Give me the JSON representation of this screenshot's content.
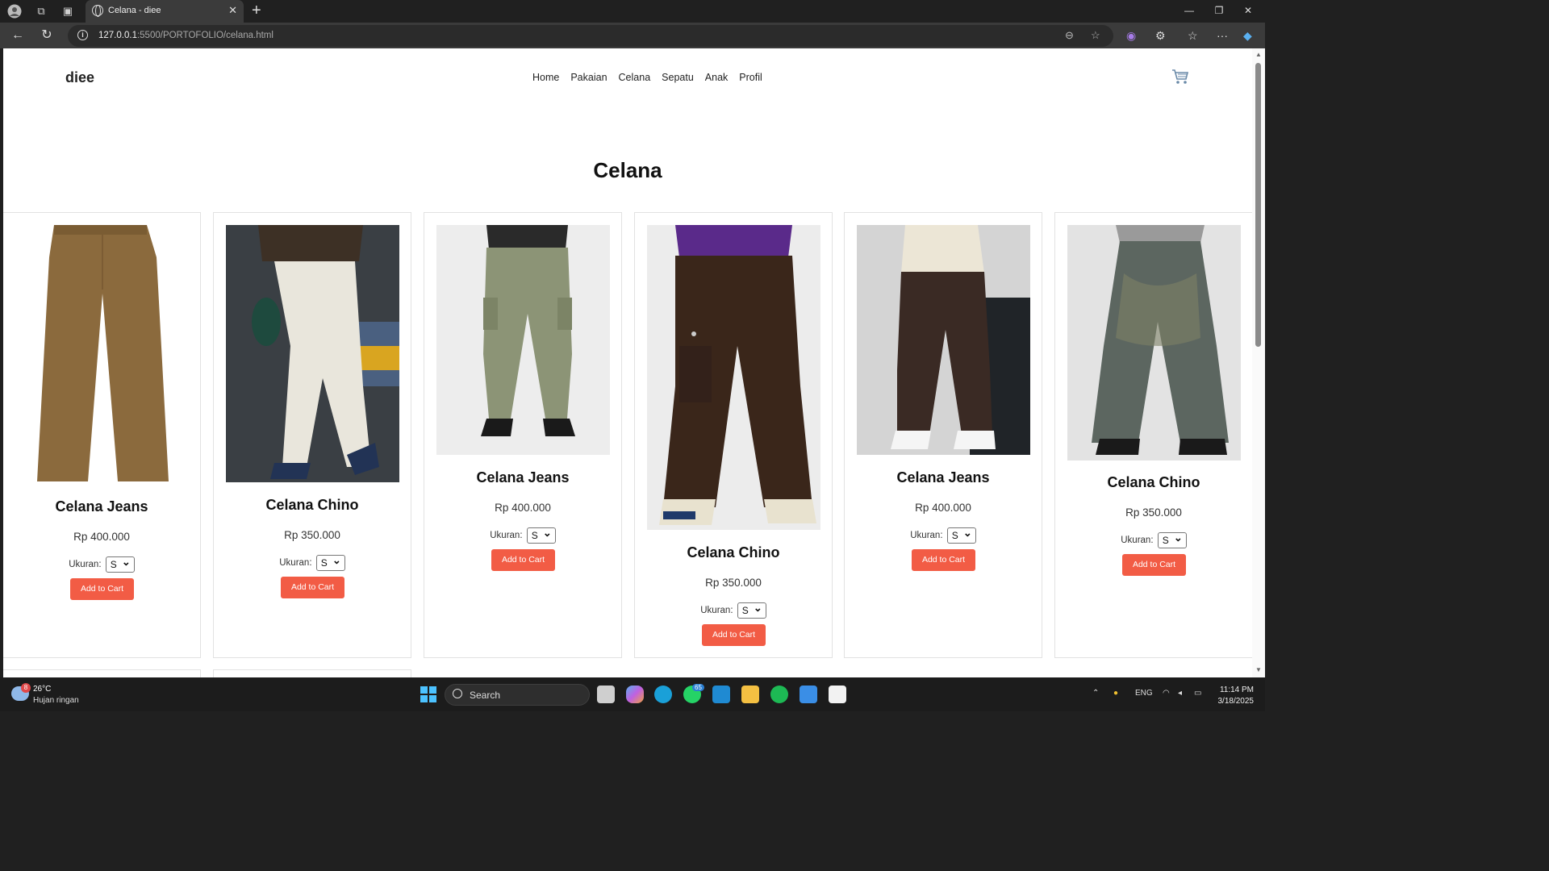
{
  "browser": {
    "tab_title": "Celana - diee",
    "url_host": "127.0.0.1",
    "url_path": ":5500/PORTOFOLIO/celana.html"
  },
  "site": {
    "logo": "diee",
    "nav": [
      "Home",
      "Pakaian",
      "Celana",
      "Sepatu",
      "Anak",
      "Profil"
    ],
    "page_title": "Celana",
    "size_label": "Ukuran:",
    "button_label": "Add to Cart",
    "accent_color": "#f25c45"
  },
  "products": [
    {
      "name": "Celana Jeans",
      "price": "Rp 400.000",
      "size": "S"
    },
    {
      "name": "Celana Chino",
      "price": "Rp 350.000",
      "size": "S"
    },
    {
      "name": "Celana Jeans",
      "price": "Rp 400.000",
      "size": "S"
    },
    {
      "name": "Celana Chino",
      "price": "Rp 350.000",
      "size": "S"
    },
    {
      "name": "Celana Jeans",
      "price": "Rp 400.000",
      "size": "S"
    },
    {
      "name": "Celana Chino",
      "price": "Rp 350.000",
      "size": "S"
    }
  ],
  "taskbar": {
    "temperature": "26°C",
    "condition": "Hujan ringan",
    "weather_badge": "8",
    "search_label": "Search",
    "whatsapp_badge": "65",
    "language": "ENG",
    "time": "11:14 PM",
    "date": "3/18/2025"
  }
}
